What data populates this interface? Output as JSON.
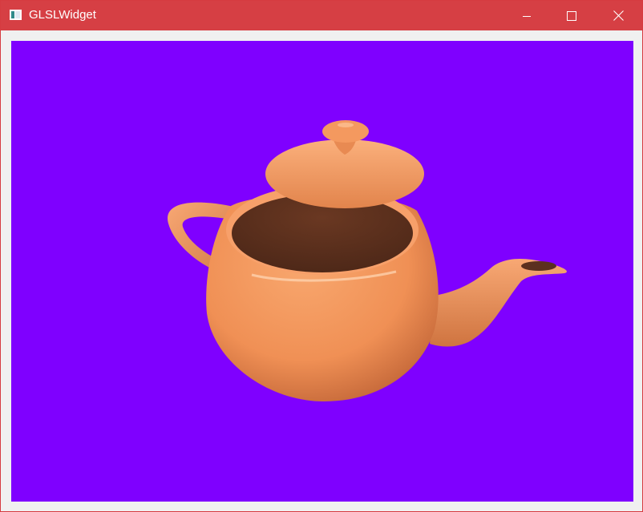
{
  "window": {
    "title": "GLSLWidget",
    "title_bar_color": "#d63f44",
    "frame_color": "#f0f0f0",
    "title_text_color": "#ffffff"
  },
  "caption_buttons": {
    "minimize_icon": "minimize-icon",
    "maximize_icon": "maximize-icon",
    "close_icon": "close-icon"
  },
  "viewport": {
    "background_color": "#7f00ff",
    "object": "teapot",
    "object_color": "#f59a5f",
    "object_interior_color": "#5c301f"
  }
}
